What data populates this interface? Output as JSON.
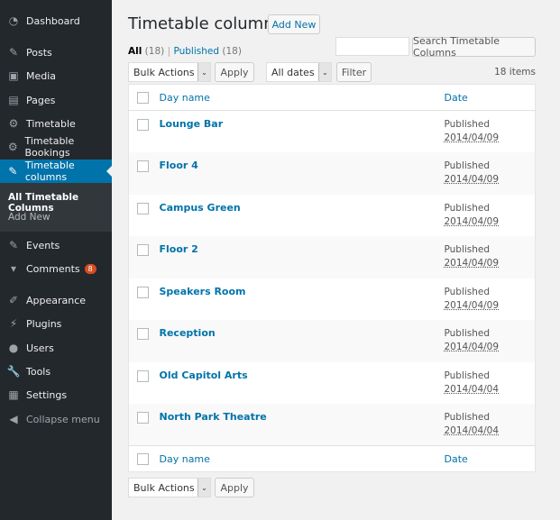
{
  "sidebar": {
    "items": [
      {
        "label": "Dashboard",
        "icon": "dashboard-icon",
        "glyph": "◔"
      },
      {
        "label": "Posts",
        "icon": "pin-icon",
        "glyph": "✎"
      },
      {
        "label": "Media",
        "icon": "media-icon",
        "glyph": "▣"
      },
      {
        "label": "Pages",
        "icon": "pages-icon",
        "glyph": "▤"
      },
      {
        "label": "Timetable",
        "icon": "gear-icon",
        "glyph": "⚙"
      },
      {
        "label": "Timetable Bookings",
        "icon": "gear-icon",
        "glyph": "⚙"
      },
      {
        "label": "Timetable columns",
        "icon": "pin-icon",
        "glyph": "✎"
      },
      {
        "label": "Events",
        "icon": "pin-icon",
        "glyph": "✎"
      },
      {
        "label": "Comments",
        "icon": "comment-icon",
        "glyph": "▾"
      },
      {
        "label": "Appearance",
        "icon": "brush-icon",
        "glyph": "✐"
      },
      {
        "label": "Plugins",
        "icon": "plugin-icon",
        "glyph": "⚡"
      },
      {
        "label": "Users",
        "icon": "user-icon",
        "glyph": "●"
      },
      {
        "label": "Tools",
        "icon": "wrench-icon",
        "glyph": "🔧"
      },
      {
        "label": "Settings",
        "icon": "settings-icon",
        "glyph": "▦"
      },
      {
        "label": "Collapse menu",
        "icon": "collapse-icon",
        "glyph": "◀"
      }
    ],
    "submenu": [
      "All Timetable Columns",
      "Add New"
    ],
    "comments_badge": "8"
  },
  "header": {
    "title": "Timetable columns",
    "add_new": "Add New"
  },
  "filters": {
    "all": "All",
    "all_count": "(18)",
    "sep": "|",
    "published": "Published",
    "published_count": "(18)"
  },
  "search": {
    "value": "",
    "button": "Search Timetable Columns"
  },
  "toolbar": {
    "bulk": "Bulk Actions",
    "apply": "Apply",
    "dates": "All dates",
    "filter": "Filter",
    "count": "18 items"
  },
  "table": {
    "col_name": "Day name",
    "col_date": "Date",
    "rows": [
      {
        "name": "Lounge Bar",
        "status": "Published",
        "date": "2014/04/09"
      },
      {
        "name": "Floor 4",
        "status": "Published",
        "date": "2014/04/09"
      },
      {
        "name": "Campus Green",
        "status": "Published",
        "date": "2014/04/09"
      },
      {
        "name": "Floor 2",
        "status": "Published",
        "date": "2014/04/09"
      },
      {
        "name": "Speakers Room",
        "status": "Published",
        "date": "2014/04/09"
      },
      {
        "name": "Reception",
        "status": "Published",
        "date": "2014/04/09"
      },
      {
        "name": "Old Capitol Arts",
        "status": "Published",
        "date": "2014/04/04"
      },
      {
        "name": "North Park Theatre",
        "status": "Published",
        "date": "2014/04/04"
      }
    ]
  }
}
